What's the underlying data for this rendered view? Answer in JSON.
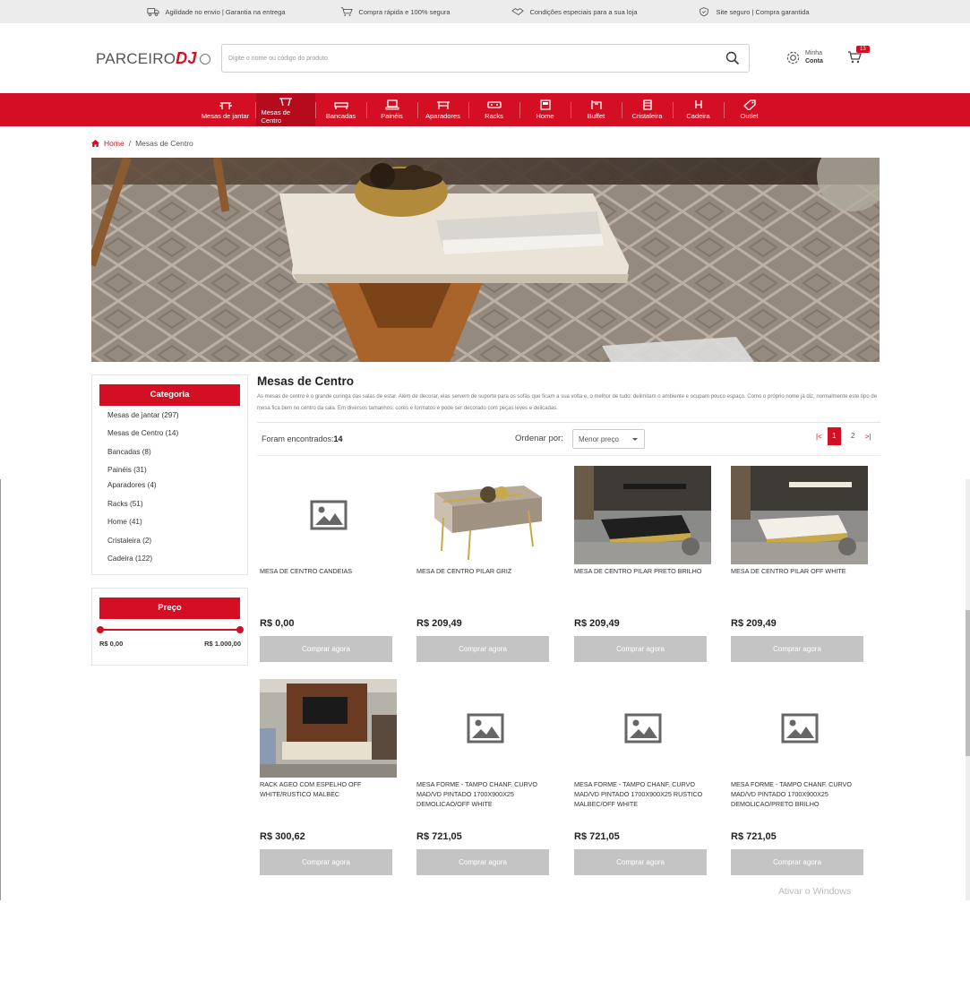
{
  "topbar": [
    {
      "icon": "truck-icon",
      "text": "Agilidade no envio  |  Garantia na entrega"
    },
    {
      "icon": "cart-icon",
      "text": "Compra rápida e 100% segura"
    },
    {
      "icon": "handshake-icon",
      "text": "Condições especiais para a sua loja"
    },
    {
      "icon": "shield-icon",
      "text": "Site seguro | Compra garantida"
    }
  ],
  "header": {
    "logo_text": "PARCEIRO",
    "logo_brand": "DJ",
    "search_placeholder": "Digite o nome ou código do produto",
    "account_line1": "Minha",
    "account_line2": "Conta",
    "cart_count": "13"
  },
  "nav": [
    {
      "label": "Mesas de jantar",
      "icon": "dining-table-icon",
      "active": false
    },
    {
      "label": "Mesas de Centro",
      "icon": "coffee-table-icon",
      "active": true
    },
    {
      "label": "Bancadas",
      "icon": "bench-icon",
      "active": false
    },
    {
      "label": "Painéis",
      "icon": "tv-panel-icon",
      "active": false
    },
    {
      "label": "Aparadores",
      "icon": "sideboard-icon",
      "active": false
    },
    {
      "label": "Racks",
      "icon": "rack-icon",
      "active": false
    },
    {
      "label": "Home",
      "icon": "home-theater-icon",
      "active": false
    },
    {
      "label": "Buffet",
      "icon": "buffet-icon",
      "active": false
    },
    {
      "label": "Cristaleira",
      "icon": "cabinet-icon",
      "active": false
    },
    {
      "label": "Cadeira",
      "icon": "chair-icon",
      "active": false
    },
    {
      "label": "Outlet",
      "icon": "tag-icon",
      "active": false
    }
  ],
  "breadcrumb": {
    "home": "Home",
    "current": "Mesas de Centro"
  },
  "sidebar": {
    "category_title": "Categoria",
    "categories": [
      "Mesas de jantar (297)",
      "Mesas de Centro (14)",
      "Bancadas (8)",
      "Painéis (31)",
      "Aparadores (4)",
      "Racks (51)",
      "Home (41)",
      "Cristaleira (2)",
      "Cadeira (122)"
    ],
    "price_title": "Preço",
    "price_min": "R$ 0,00",
    "price_max": "R$ 1.000,00"
  },
  "main": {
    "title": "Mesas de Centro",
    "description": "As mesas de centro é o grande curinga das salas de estar. Além de decorar, elas servem de suporte para os sofás que ficam a sua volta e, o melhor de tudo: delimitam o ambiente e ocupam pouco espaço. Como o próprio nome já diz, normalmente este tipo de mesa fica bem no centro da sala. Em diversos tamanhos, cores e formatos e pode ser decorado com peças leves e delicadas.",
    "found_label": "Foram encontrados:",
    "found_count": "14",
    "sort_label": "Ordenar por:",
    "sort_value": "Menor preço",
    "pages": [
      "1",
      "2"
    ]
  },
  "products": [
    {
      "name": "MESA DE CENTRO CANDEIAS",
      "price": "R$ 0,00",
      "button": "Comprar agora",
      "image": "placeholder"
    },
    {
      "name": "MESA DE CENTRO PILAR GRIZ",
      "price": "R$ 209,49",
      "button": "Comprar agora",
      "image": "table-griz"
    },
    {
      "name": "MESA DE CENTRO PILAR PRETO BRILHO",
      "price": "R$ 209,49",
      "button": "Comprar agora",
      "image": "room-black"
    },
    {
      "name": "MESA DE CENTRO PILAR OFF WHITE",
      "price": "R$ 209,49",
      "button": "Comprar agora",
      "image": "room-white"
    },
    {
      "name": "RACK AGEO COM ESPELHO OFF WHITE/RUSTICO MALBEC",
      "price": "R$ 300,62",
      "button": "Comprar agora",
      "image": "rack-room"
    },
    {
      "name": "MESA FORME - TAMPO CHANF. CURVO MAD/VD PINTADO 1700X900X25 DEMOLICAO/OFF WHITE",
      "price": "R$ 721,05",
      "button": "Comprar agora",
      "image": "placeholder"
    },
    {
      "name": "MESA FORME - TAMPO CHANF. CURVO MAD/VD PINTADO 1700X900X25 RUSTICO MALBEC/OFF WHITE",
      "price": "R$ 721,05",
      "button": "Comprar agora",
      "image": "placeholder"
    },
    {
      "name": "MESA FORME - TAMPO CHANF. CURVO MAD/VD PINTADO 1700X900X25 DEMOLICAO/PRETO BRILHO",
      "price": "R$ 721,05",
      "button": "Comprar agora",
      "image": "placeholder"
    }
  ],
  "watermark": "Ativar o Windows",
  "colors": {
    "accent": "#d40f23",
    "button_gray": "#c4c4c4",
    "topbar": "#ececec"
  }
}
